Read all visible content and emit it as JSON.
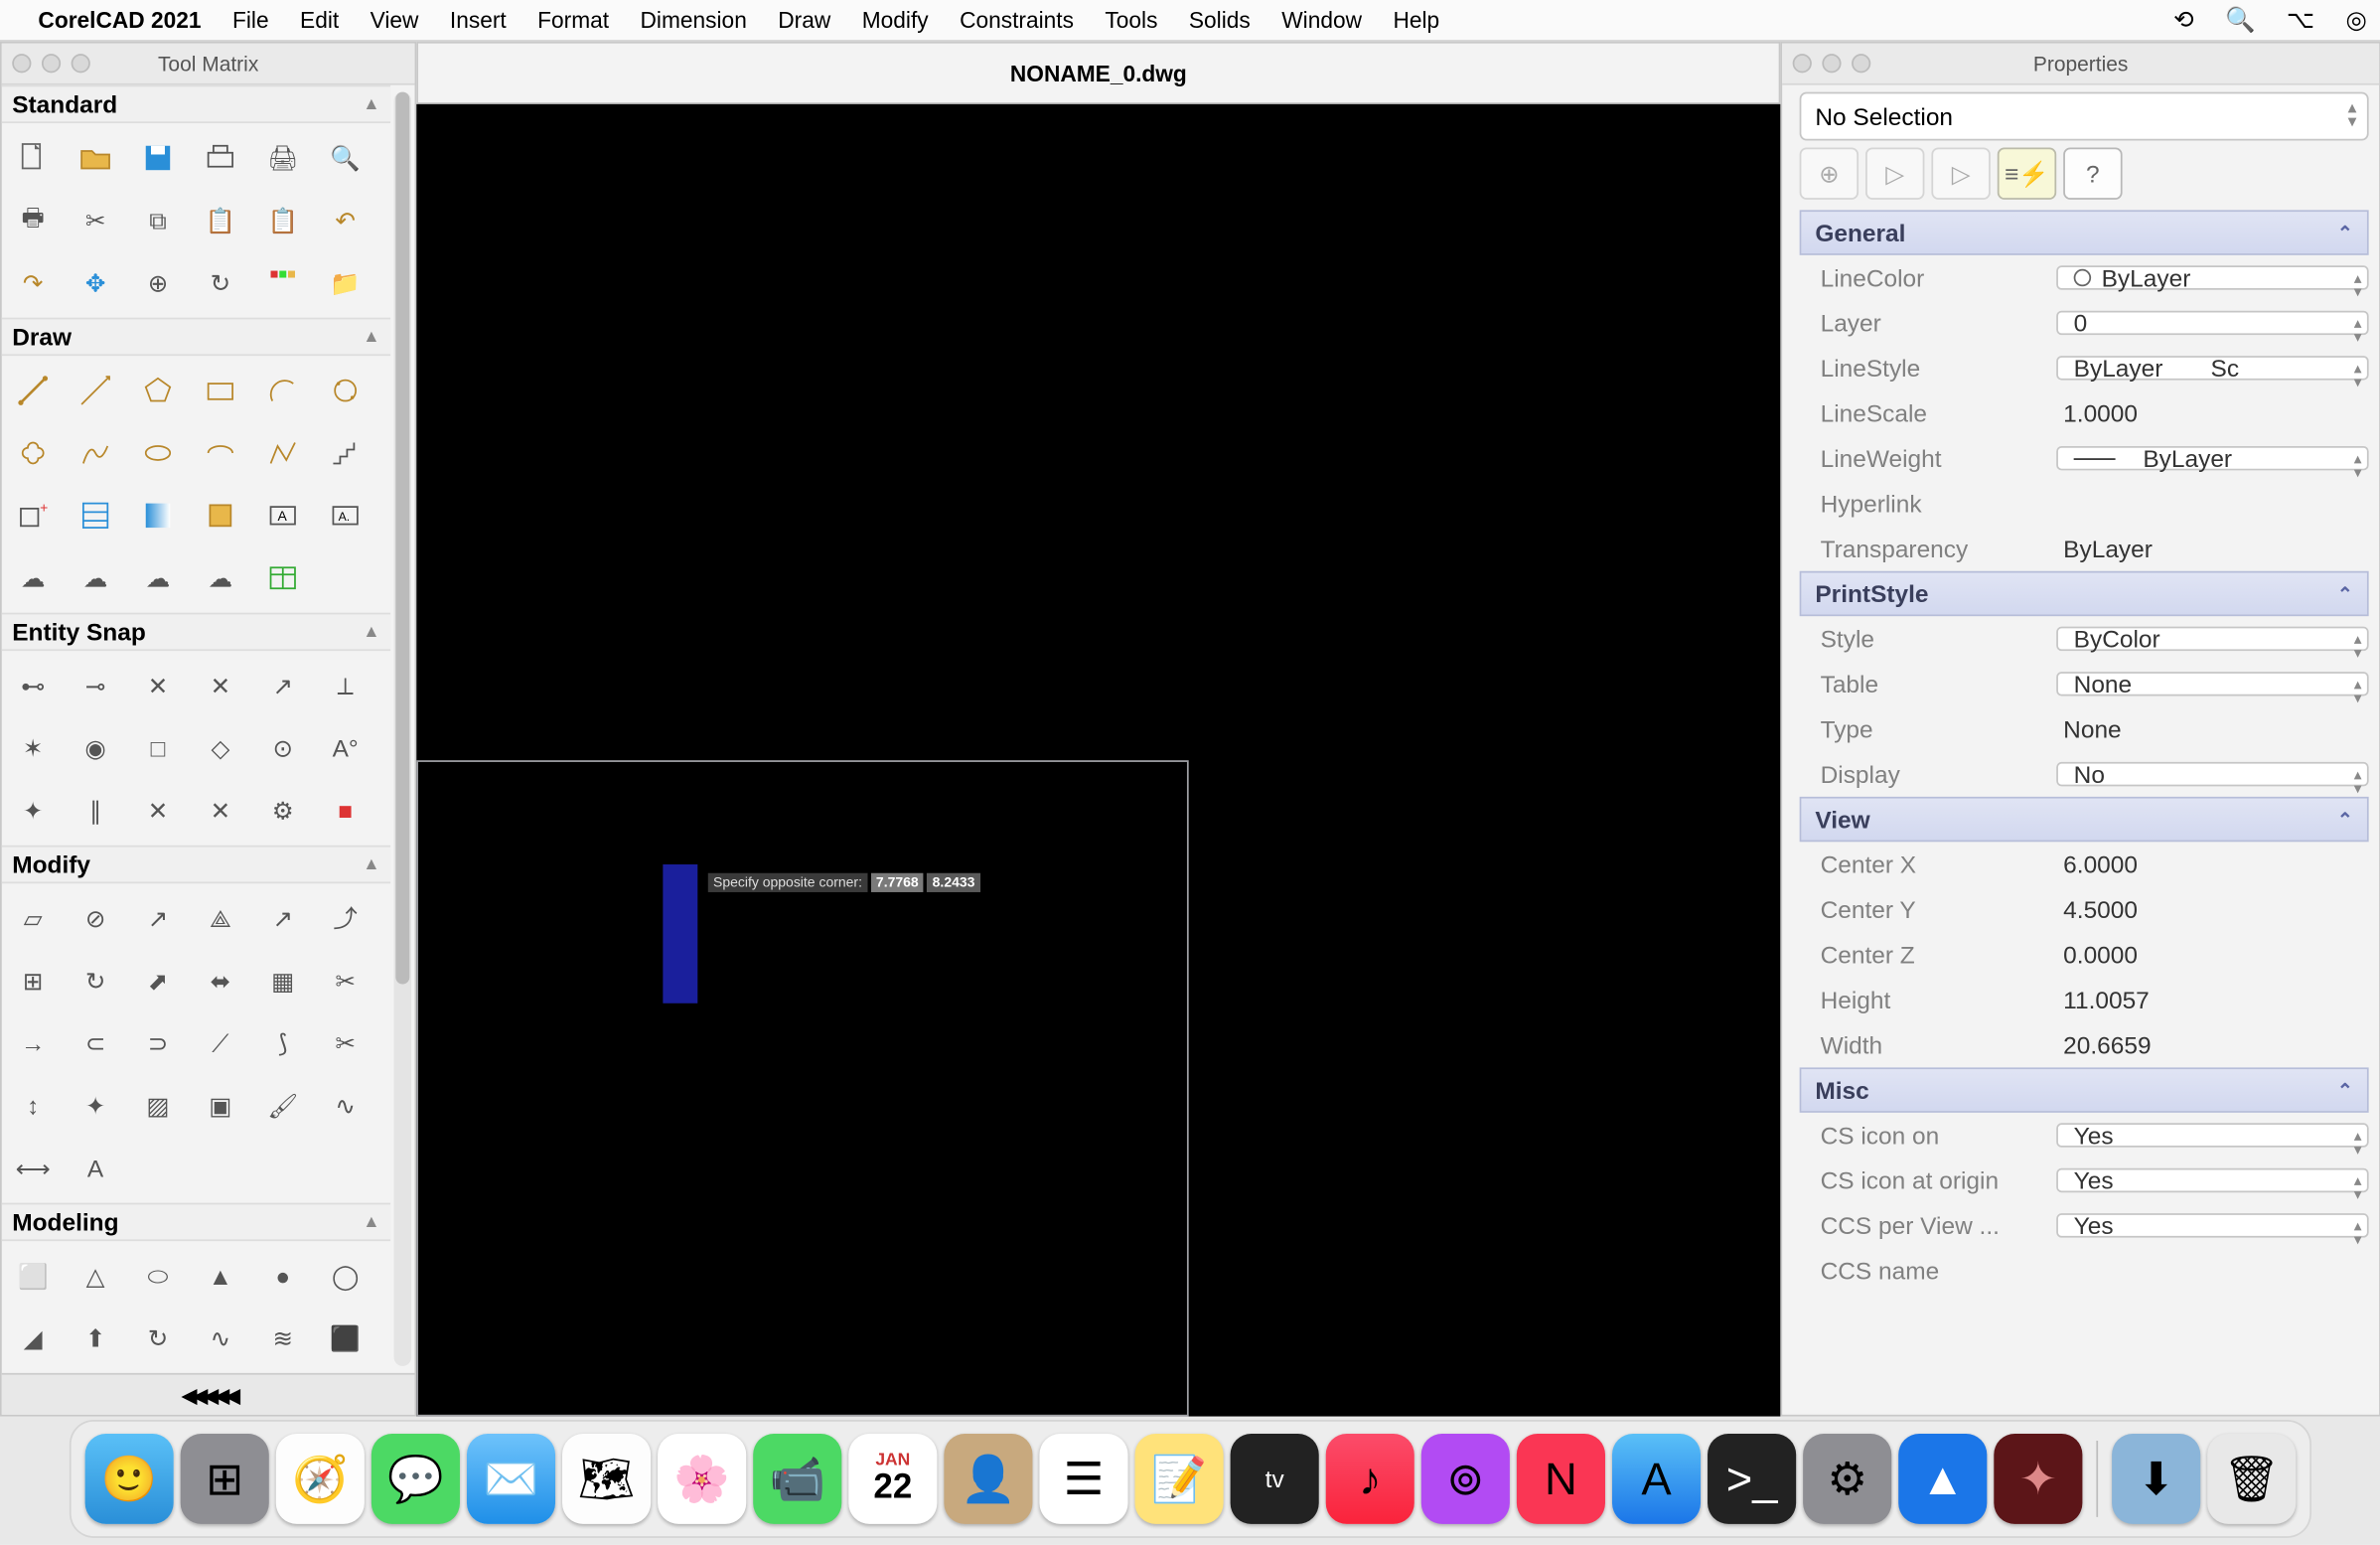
{
  "menubar": {
    "app": "CorelCAD 2021",
    "items": [
      "File",
      "Edit",
      "View",
      "Insert",
      "Format",
      "Dimension",
      "Draw",
      "Modify",
      "Constraints",
      "Tools",
      "Solids",
      "Window",
      "Help"
    ]
  },
  "document_title": "NONAME_0.dwg",
  "toolmatrix": {
    "title": "Tool Matrix",
    "sections": {
      "standard": "Standard",
      "draw": "Draw",
      "esnap": "Entity Snap",
      "modify": "Modify",
      "modeling": "Modeling"
    },
    "footer": "◀◀◀◀◀"
  },
  "canvas": {
    "prompt": "Specify opposite corner:",
    "coord_x": "7.7768",
    "coord_y": "8.2433"
  },
  "properties": {
    "title": "Properties",
    "selection": "No Selection",
    "help": "?",
    "groups": {
      "general": {
        "label": "General",
        "linecolor_l": "LineColor",
        "linecolor_v": "ByLayer",
        "layer_l": "Layer",
        "layer_v": "0",
        "linestyle_l": "LineStyle",
        "linestyle_v": "ByLayer",
        "linestyle_ext": "Sc",
        "linescale_l": "LineScale",
        "linescale_v": "1.0000",
        "lineweight_l": "LineWeight",
        "lineweight_v": "ByLayer",
        "hyperlink_l": "Hyperlink",
        "hyperlink_v": "",
        "transparency_l": "Transparency",
        "transparency_v": "ByLayer"
      },
      "printstyle": {
        "label": "PrintStyle",
        "style_l": "Style",
        "style_v": "ByColor",
        "table_l": "Table",
        "table_v": "None",
        "type_l": "Type",
        "type_v": "None",
        "display_l": "Display",
        "display_v": "No"
      },
      "view": {
        "label": "View",
        "cx_l": "Center X",
        "cx_v": "6.0000",
        "cy_l": "Center Y",
        "cy_v": "4.5000",
        "cz_l": "Center Z",
        "cz_v": "0.0000",
        "h_l": "Height",
        "h_v": "11.0057",
        "w_l": "Width",
        "w_v": "20.6659"
      },
      "misc": {
        "label": "Misc",
        "ci_l": "CS icon on",
        "ci_v": "Yes",
        "co_l": "CS icon at origin",
        "co_v": "Yes",
        "cp_l": "CCS per View ...",
        "cp_v": "Yes",
        "cn_l": "CCS name",
        "cn_v": ""
      }
    }
  },
  "dock": {
    "cal_month": "JAN",
    "cal_day": "22"
  }
}
